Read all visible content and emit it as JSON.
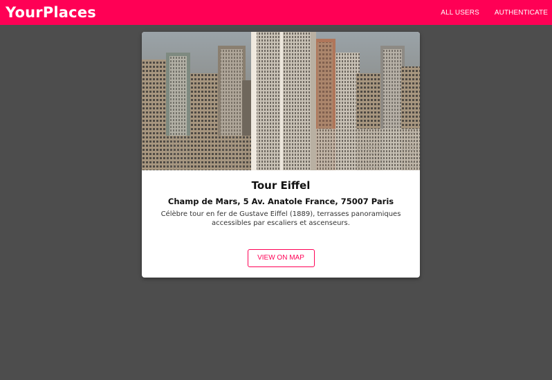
{
  "header": {
    "logo": "YourPlaces",
    "nav": [
      "ALL USERS",
      "AUTHENTICATE"
    ]
  },
  "place": {
    "title": "Tour Eiffel",
    "address": "Champ de Mars, 5 Av. Anatole France, 75007 Paris",
    "description": "Célèbre tour en fer de Gustave Eiffel (1889), terrasses panoramiques accessibles par escaliers et ascenseurs.",
    "view_on_map": "VIEW ON MAP"
  },
  "colors": {
    "brand": "#ff0055",
    "background": "#4d4d4d"
  }
}
